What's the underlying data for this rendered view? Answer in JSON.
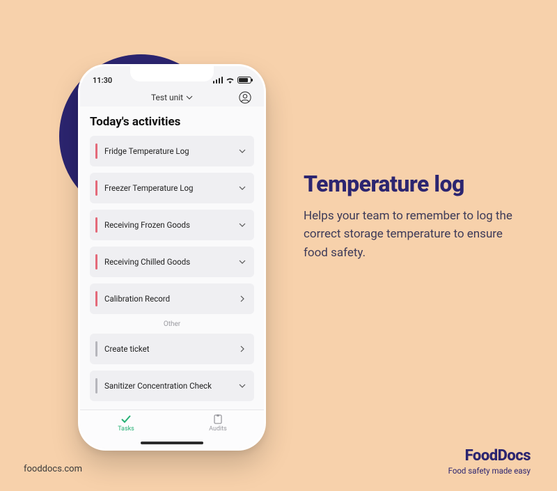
{
  "status": {
    "time": "11:30"
  },
  "header": {
    "unit": "Test unit"
  },
  "screen": {
    "title": "Today's activities",
    "section_other": "Other",
    "activities": [
      {
        "label": "Fridge Temperature Log",
        "accent": "red",
        "chev": "down"
      },
      {
        "label": "Freezer Temperature Log",
        "accent": "red",
        "chev": "down"
      },
      {
        "label": "Receiving Frozen Goods",
        "accent": "red",
        "chev": "down"
      },
      {
        "label": "Receiving Chilled Goods",
        "accent": "red",
        "chev": "down"
      },
      {
        "label": "Calibration Record",
        "accent": "red",
        "chev": "right"
      }
    ],
    "other_activities": [
      {
        "label": "Create ticket",
        "accent": "gray",
        "chev": "right"
      },
      {
        "label": "Sanitizer Concentration Check",
        "accent": "gray",
        "chev": "down"
      }
    ]
  },
  "nav": {
    "tasks": "Tasks",
    "audits": "Audits"
  },
  "promo": {
    "title": "Temperature log",
    "body": "Helps your team to remember to log the correct storage temperature to ensure food safety."
  },
  "footer": {
    "url": "fooddocs.com",
    "brand": "FoodDocs",
    "tagline": "Food safety made easy"
  }
}
